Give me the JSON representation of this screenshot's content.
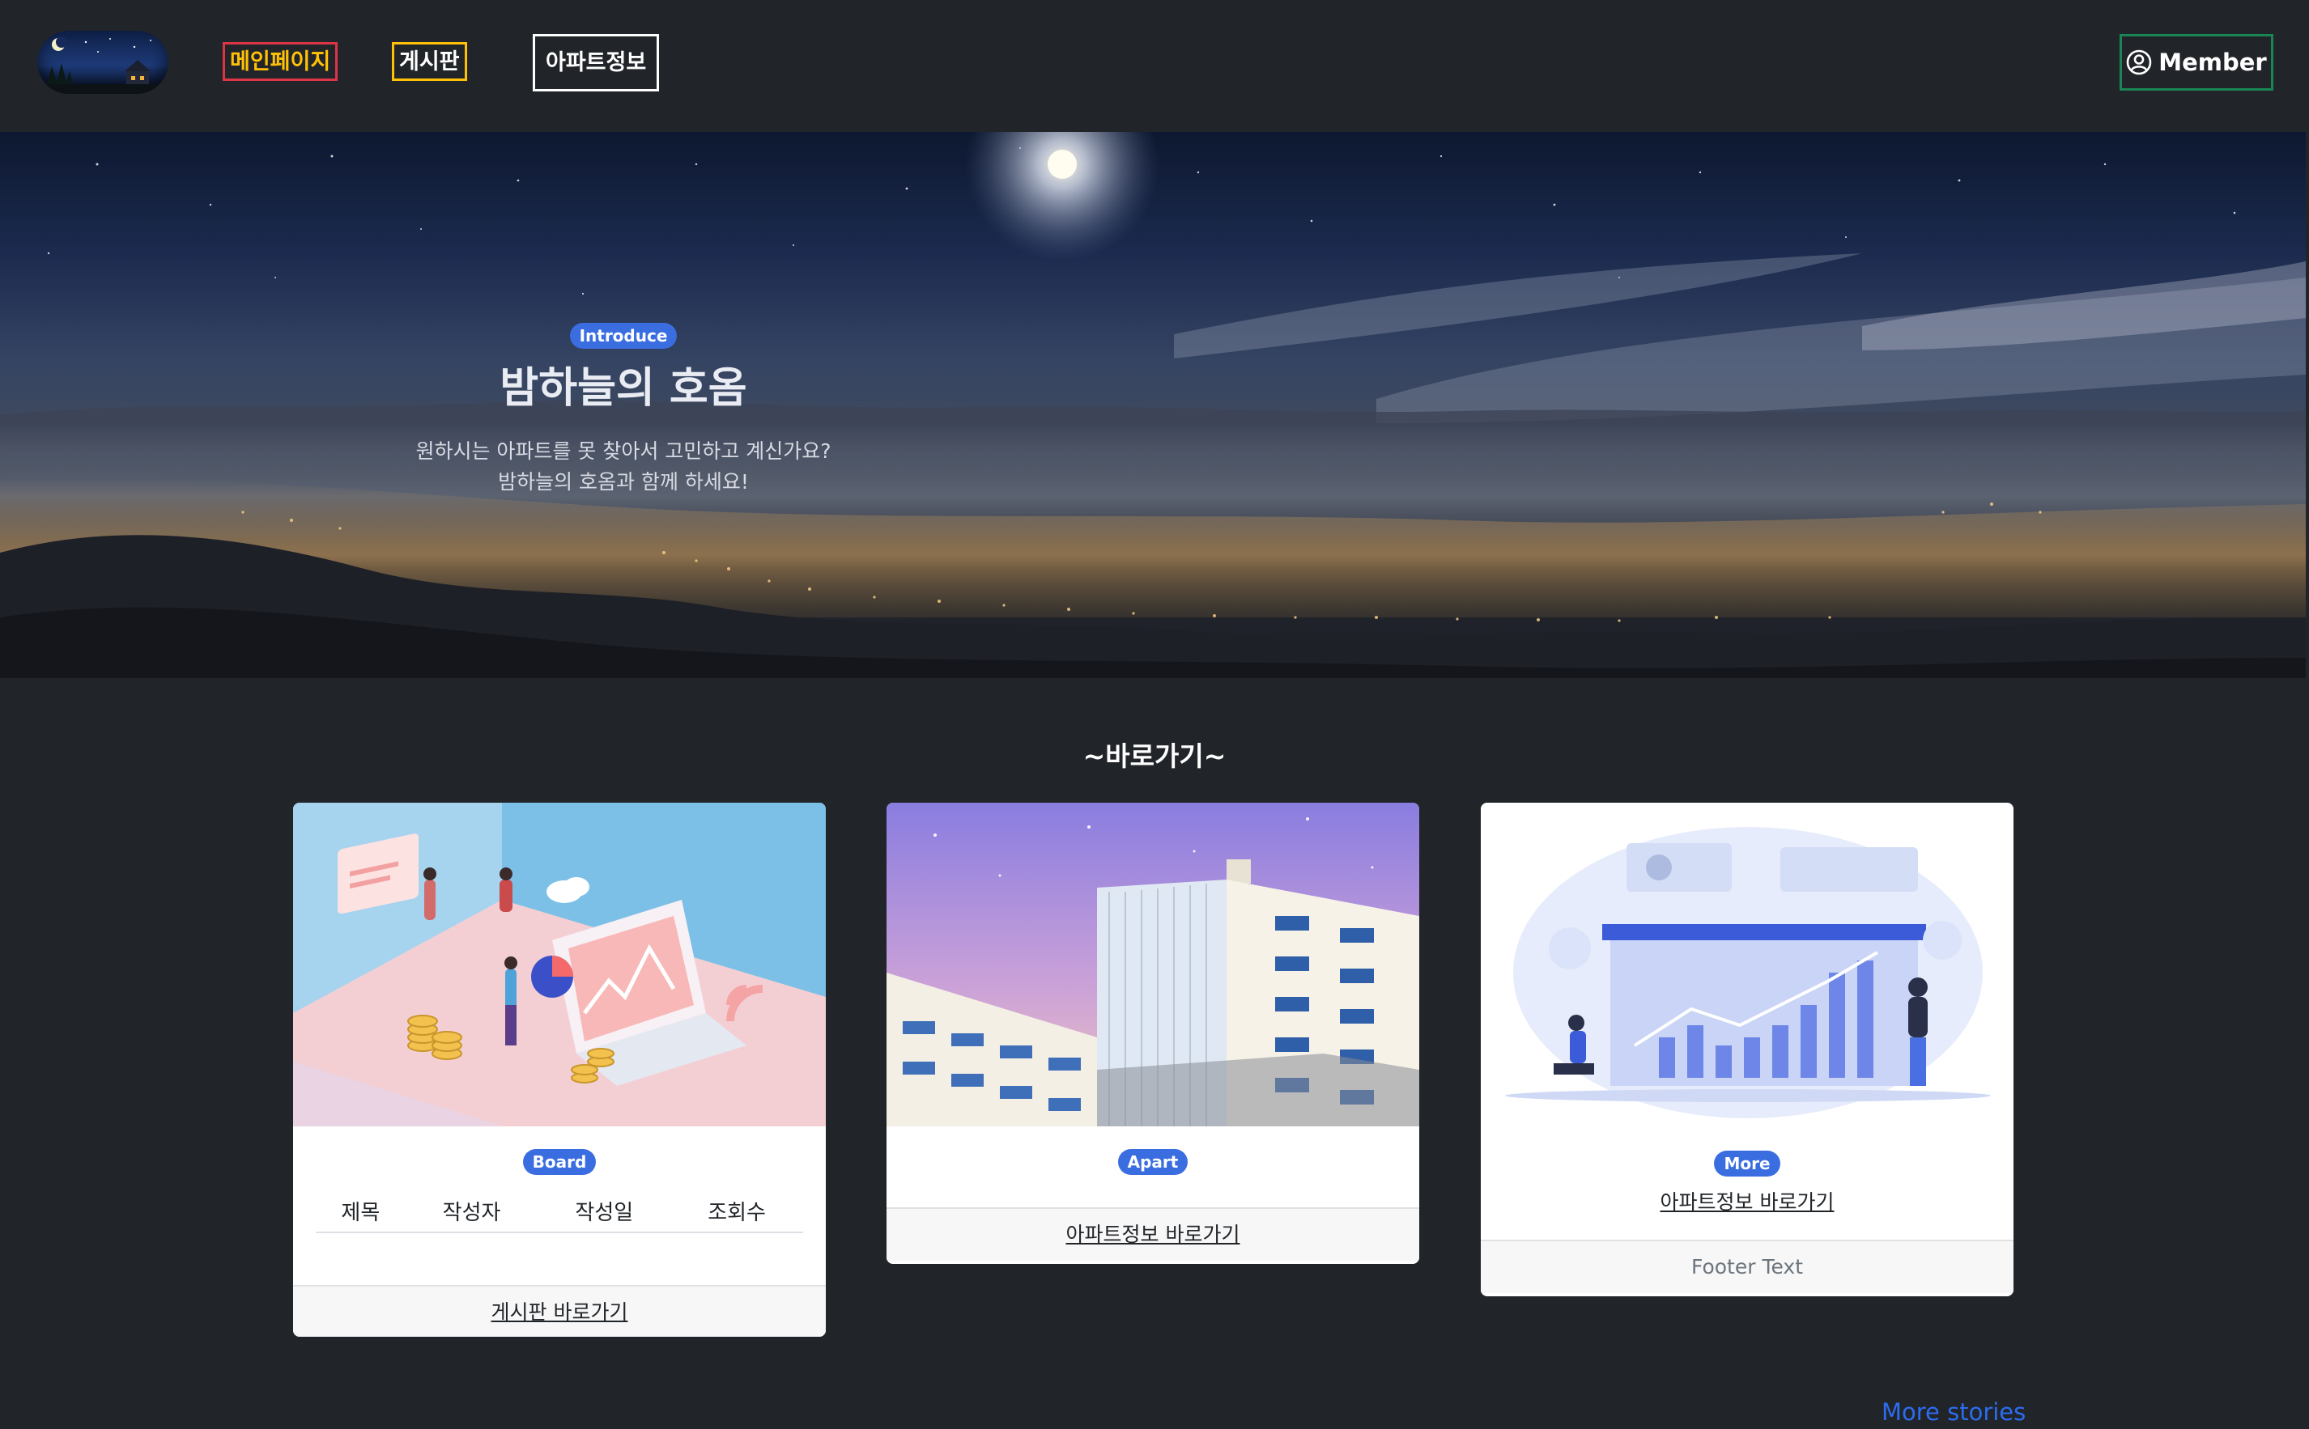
{
  "nav": {
    "logo_alt": "logo",
    "main_label": "메인페이지",
    "board_label": "게시판",
    "apart_label": "아파트정보",
    "member_label": "Member"
  },
  "hero": {
    "badge": "Introduce",
    "title": "밤하늘의 호옴",
    "subtitle_line1": "원하시는 아파트를 못 찾아서 고민하고 계신가요?",
    "subtitle_line2": "밤하늘의 호옴과 함께 하세요!"
  },
  "section": {
    "title": "~바로가기~"
  },
  "cards": {
    "board": {
      "badge": "Board",
      "columns": [
        "제목",
        "작성자",
        "작성일",
        "조회수"
      ],
      "footer_link": "게시판 바로가기"
    },
    "apart": {
      "badge": "Apart",
      "footer_link": "아파트정보 바로가기"
    },
    "more": {
      "badge": "More",
      "link": "아파트정보 바로가기",
      "footer": "Footer Text"
    }
  },
  "more_stories": "More stories",
  "colors": {
    "background": "#212529",
    "badge": "#3a6ee0",
    "main_link_border": "#dc3545",
    "main_link_text": "#ffc107",
    "board_link_border": "#ffc107",
    "member_border": "#198754",
    "more_stories": "#2c6cf0"
  },
  "icons": {
    "member": "person-circle-icon"
  }
}
